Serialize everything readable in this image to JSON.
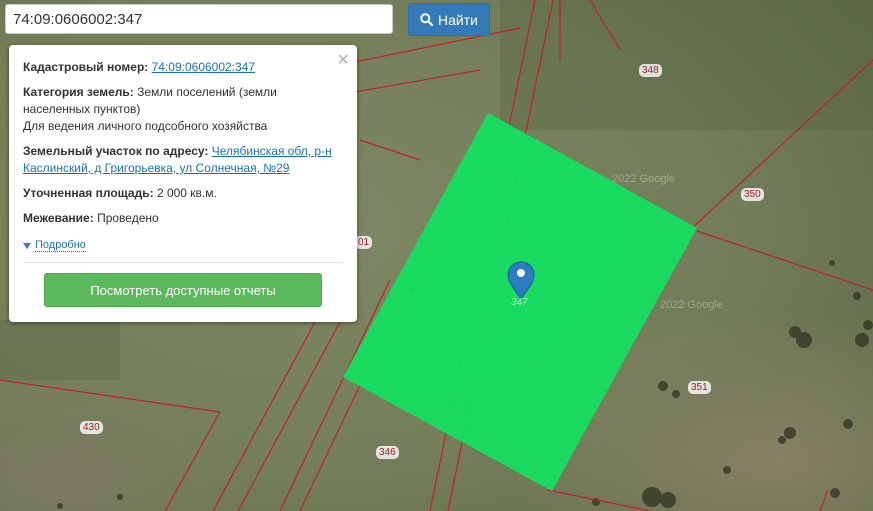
{
  "search": {
    "value": "74:09:0606002:347",
    "button_label": "Найти",
    "button_color": "#337ab7"
  },
  "popup": {
    "close_symbol": "×",
    "cadastral_label": "Кадастровый номер:",
    "cadastral_value": "74:09:0606002:347",
    "category_label": "Категория земель:",
    "category_value_1": "Земли поселений (земли",
    "category_value_2": "населенных пунктов)",
    "category_value_3": "Для ведения личного подсобного хозяйства",
    "address_label": "Земельный участок по адресу:",
    "address_value_1": "Челябинская обл, р-н",
    "address_value_2": "Каслинский, д Григорьевка, ул Солнечная, №29",
    "area_label": "Уточненная площадь:",
    "area_value": "2 000 кв.м.",
    "survey_label": "Межевание:",
    "survey_value": "Проведено",
    "more_label": "Подробно",
    "reports_button": "Посмотреть доступные отчеты",
    "reports_color": "#5cb85c"
  },
  "map": {
    "plot_color": "#13e060",
    "boundary_color": "#c0222c",
    "marker_color": "#2b7dc2",
    "watermark": "2022 Google",
    "selected_plot_label": "347",
    "plot_labels": [
      "348",
      "350",
      "351",
      "346",
      "430",
      "01"
    ]
  }
}
